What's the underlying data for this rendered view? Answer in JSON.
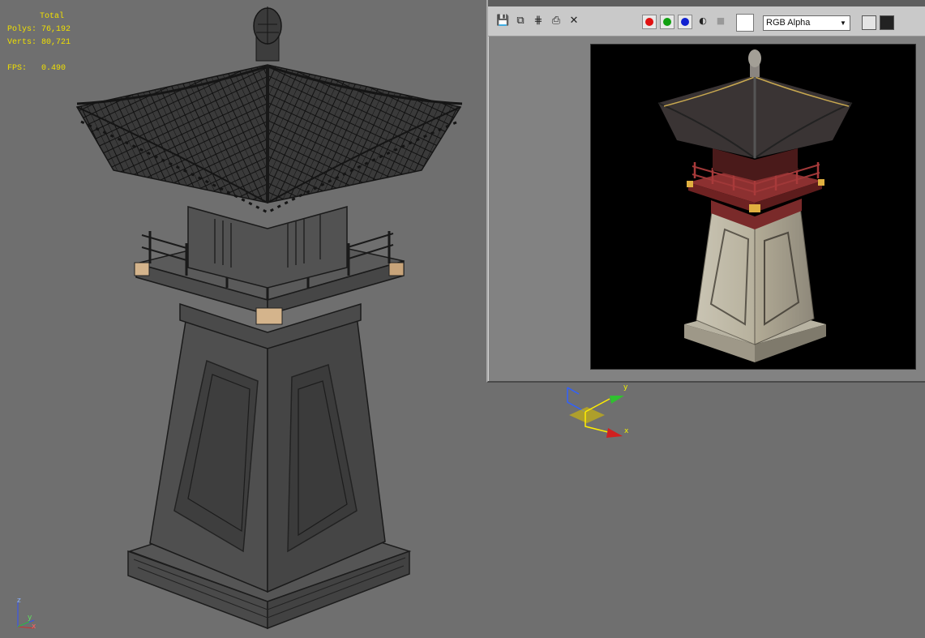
{
  "stats": {
    "header": "Total",
    "polys_label": "Polys:",
    "polys_value": "76,192",
    "verts_label": "Verts:",
    "verts_value": "80,721",
    "fps_label": "FPS:",
    "fps_value": "0.490"
  },
  "render_window": {
    "channel_select": "RGB Alpha",
    "channels": [
      "red-channel",
      "green-channel",
      "blue-channel"
    ]
  },
  "gizmo": {
    "x_label": "x",
    "y_label": "y"
  },
  "corner_axis": {
    "x_label": "x",
    "y_label": "y",
    "z_label": "z"
  },
  "colors": {
    "viewport_bg": "#6f6f6f",
    "stats_text": "#f0e000",
    "render_bg": "#000000"
  }
}
